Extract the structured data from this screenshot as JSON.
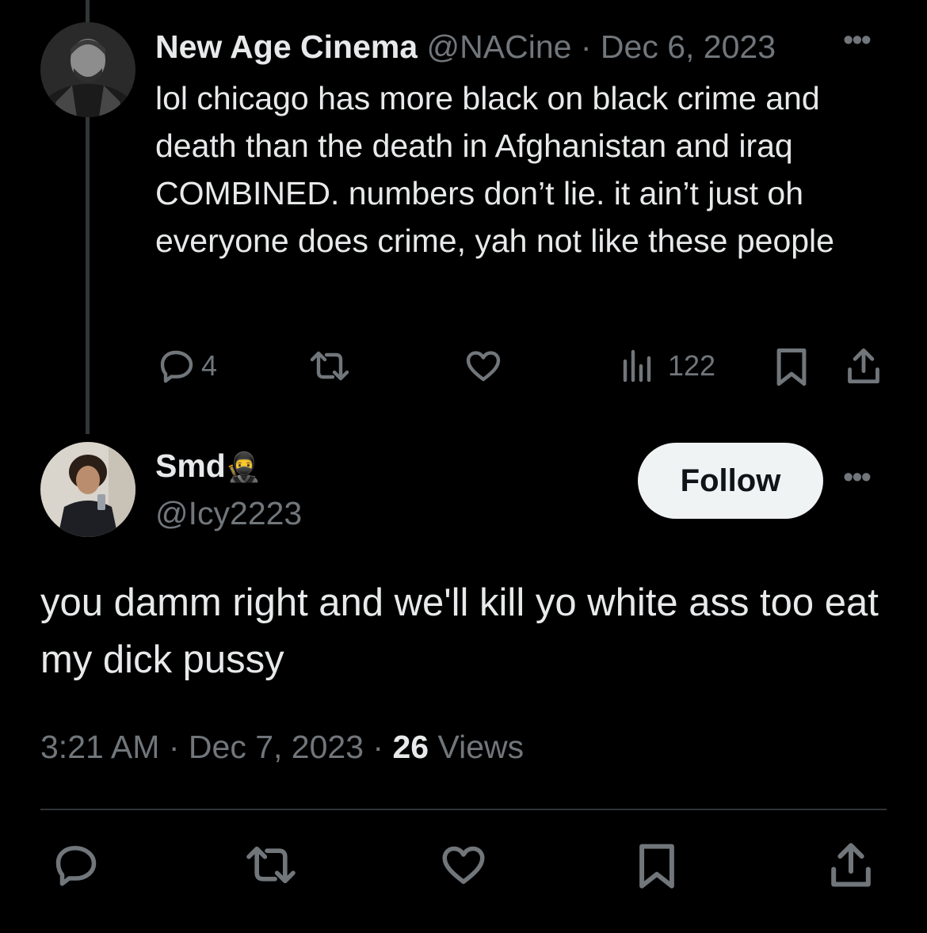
{
  "parent_tweet": {
    "display_name": "New Age Cinema",
    "handle": "@NACine",
    "separator": "·",
    "date": "Dec 6, 2023",
    "more": "•••",
    "text": "lol chicago has more black on black crime and death than the death in Afghanistan and iraq COMBINED. numbers don’t lie. it ain’t just oh everyone does crime, yah not like these people",
    "actions": {
      "reply_count": "4",
      "views_count": "122"
    }
  },
  "reply_tweet": {
    "display_name": "Smd",
    "name_emoji": "🥷",
    "handle": "@Icy2223",
    "follow_label": "Follow",
    "more": "•••",
    "text": "you damm right and we'll kill yo white ass too eat my dick pussy",
    "time": "3:21 AM",
    "separator": "·",
    "date": "Dec 7, 2023",
    "views_count": "26",
    "views_label": "Views"
  },
  "icons": [
    "reply-icon",
    "retweet-icon",
    "like-icon",
    "views-icon",
    "bookmark-icon",
    "share-icon"
  ],
  "colors": {
    "background": "#000000",
    "text": "#e7e9ea",
    "muted": "#71767b",
    "follow_bg": "#eff3f4"
  }
}
